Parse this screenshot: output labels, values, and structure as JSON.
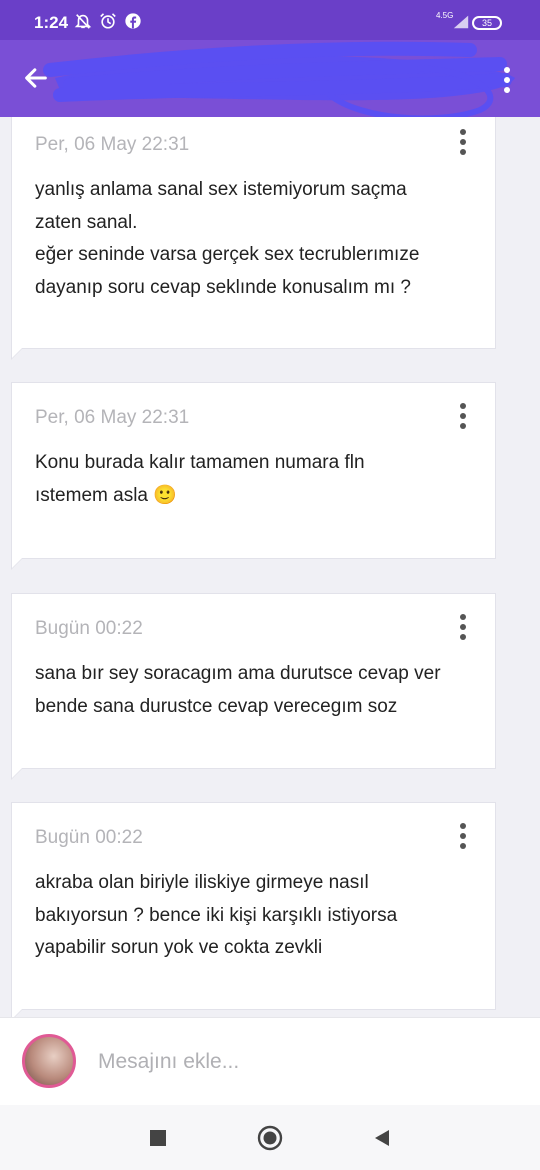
{
  "status_bar": {
    "time": "1:24",
    "network_label": "4.5G",
    "battery_level": "35",
    "icons": [
      "mute-icon",
      "alarm-icon",
      "facebook-icon",
      "signal-icon"
    ]
  },
  "app_bar": {
    "icons": [
      "back-arrow-icon",
      "overflow-menu-icon"
    ],
    "colors": {
      "primary": "#7a4fd6",
      "status": "#6a3fc8",
      "redaction": "#5a4ff2"
    }
  },
  "messages": [
    {
      "timestamp": "Per, 06 May 22:31",
      "lines": [
        "yanlış anlama sanal sex istemiyorum saçma",
        "zaten sanal.",
        "eğer seninde varsa gerçek sex tecrublerımıze",
        "dayanıp soru cevap seklınde konusalım mı ?"
      ]
    },
    {
      "timestamp": "Per, 06 May 22:31",
      "lines": [
        "Konu burada kalır tamamen numara fln",
        "ıstemem asla 🙂"
      ]
    },
    {
      "timestamp": "Bugün 00:22",
      "lines": [
        "sana bır sey soracagım ama durutsce cevap ver",
        "bende sana durustce cevap verecegım soz"
      ]
    },
    {
      "timestamp": "Bugün 00:22",
      "lines": [
        "akraba olan biriyle iliskiye girmeye nasıl",
        "bakıyorsun ? bence iki kişi karşıklı istiyorsa",
        "yapabilir sorun yok ve cokta zevkli"
      ]
    }
  ],
  "composer": {
    "placeholder": "Mesajını ekle...",
    "value": ""
  },
  "nav_bar": {
    "icons": [
      "recents-icon",
      "home-icon",
      "back-icon"
    ]
  }
}
